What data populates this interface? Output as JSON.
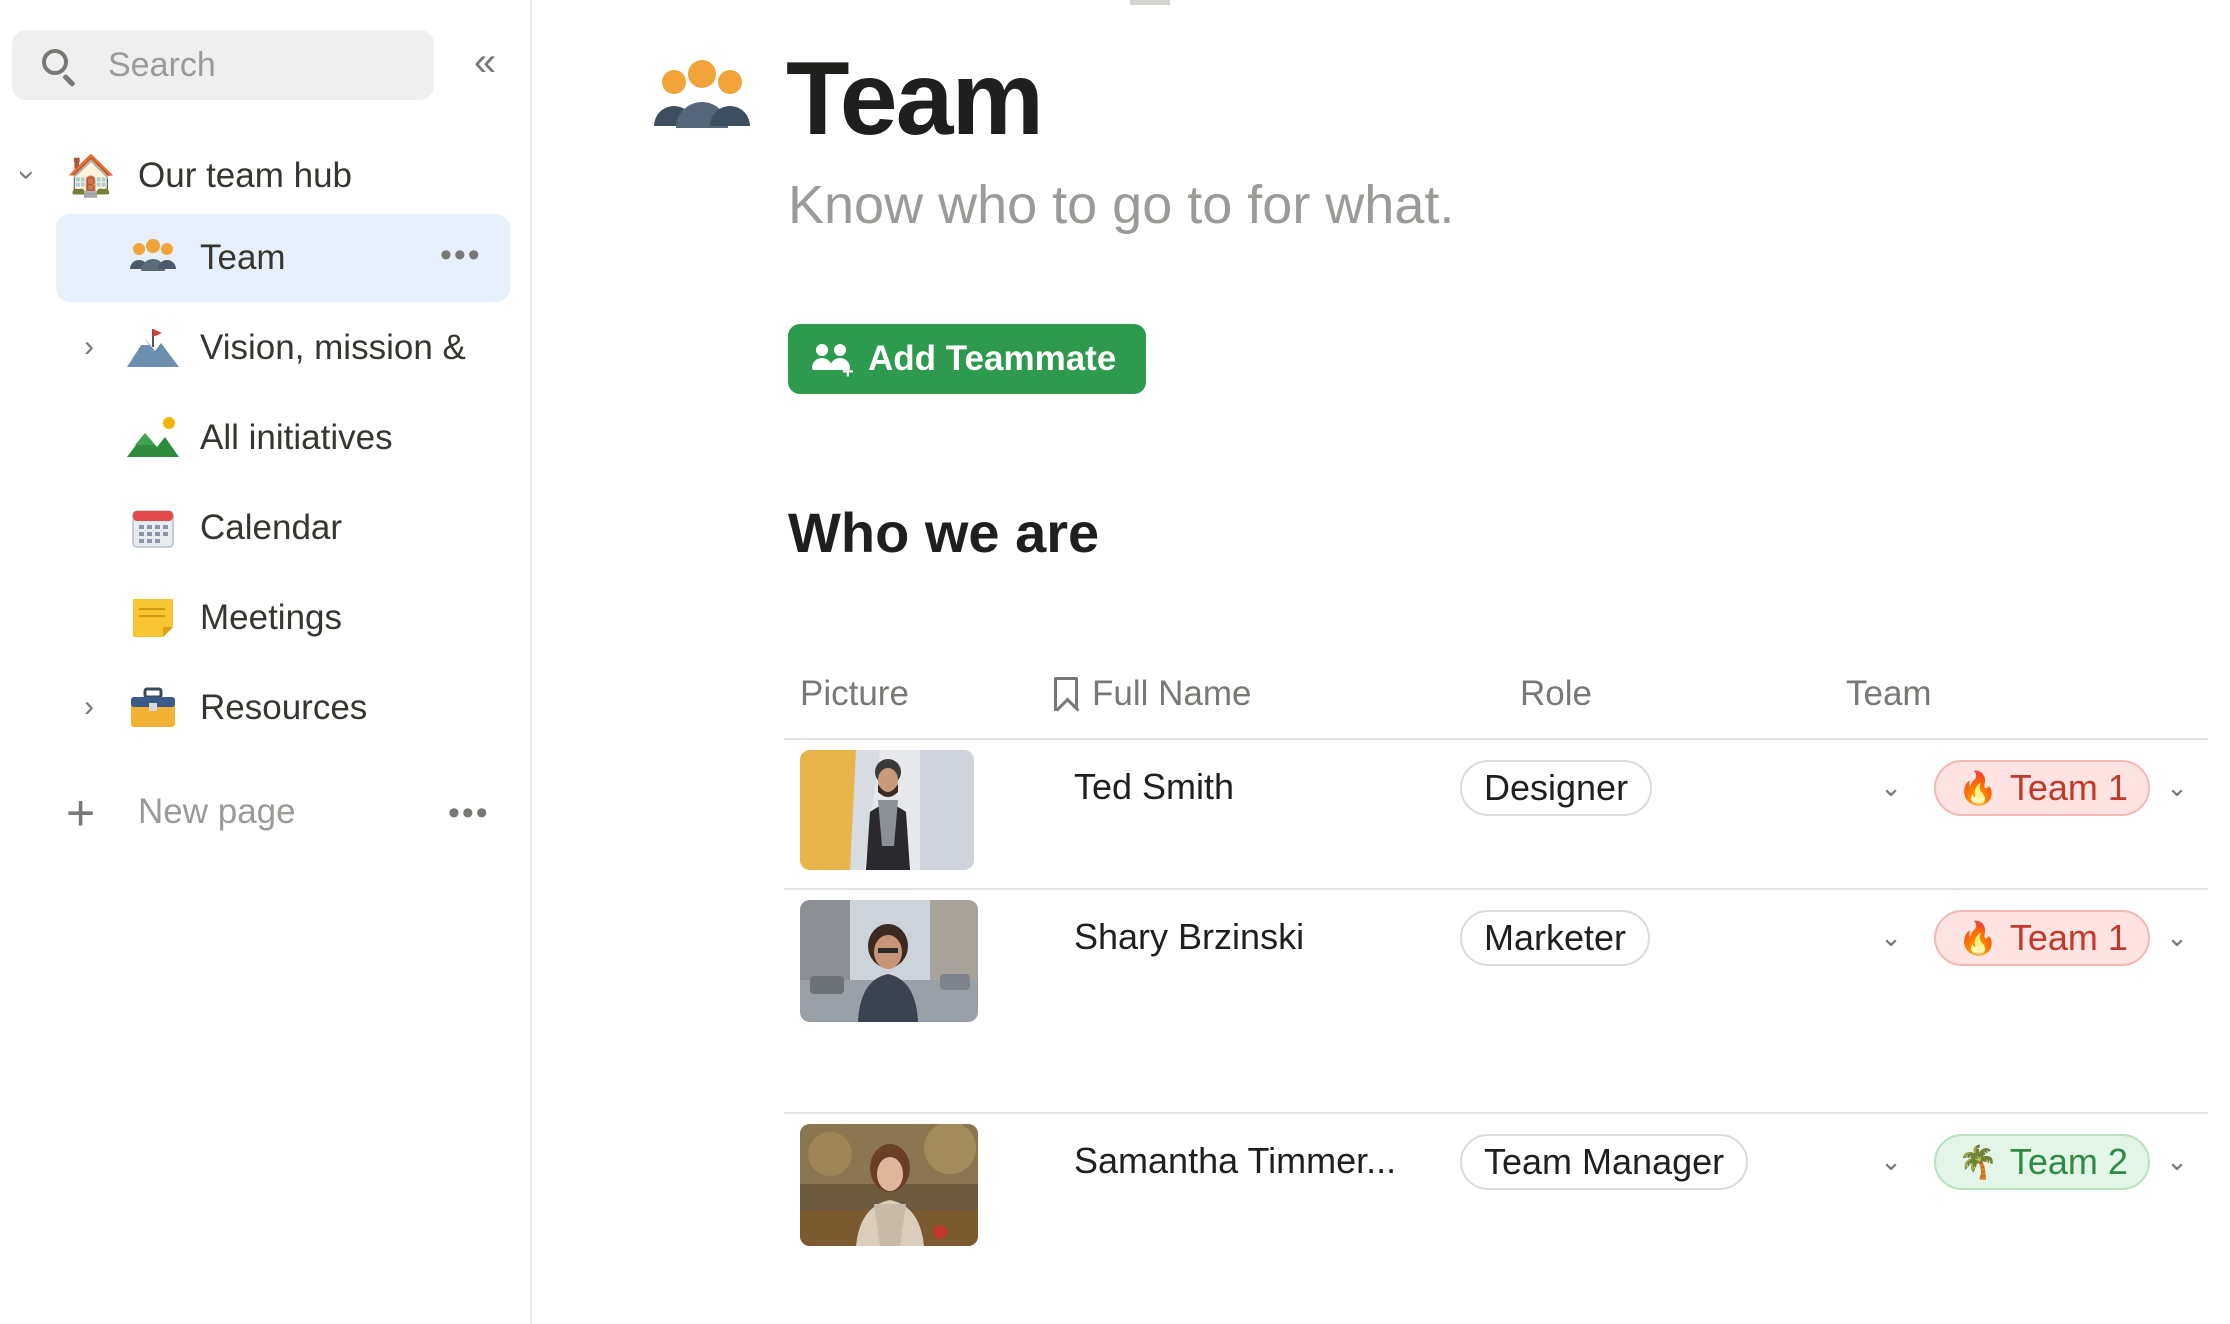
{
  "sidebar": {
    "search_placeholder": "Search",
    "collapse_glyph": "«",
    "items": [
      {
        "label": "Our team hub",
        "icon": "house-icon",
        "glyph": "🏠",
        "expandable": true,
        "expanded": true
      },
      {
        "label": "Team",
        "icon": "team-icon",
        "glyph": "👥",
        "active": true,
        "more": "•••"
      },
      {
        "label": "Vision, mission &",
        "icon": "mountain-flag-icon",
        "glyph": "🏔",
        "expandable": true
      },
      {
        "label": "All initiatives",
        "icon": "landscape-icon",
        "glyph": "⛰"
      },
      {
        "label": "Calendar",
        "icon": "calendar-icon",
        "glyph": "📅"
      },
      {
        "label": "Meetings",
        "icon": "sticky-note-icon",
        "glyph": "📝"
      },
      {
        "label": "Resources",
        "icon": "toolbox-icon",
        "glyph": "🧰",
        "expandable": true
      }
    ],
    "new_page_label": "New page",
    "new_page_more": "•••"
  },
  "page": {
    "icon": "team-icon",
    "title": "Team",
    "subtitle": "Know who to go to for what.",
    "add_button_label": "Add Teammate",
    "section_title": "Who we are"
  },
  "table": {
    "columns": [
      "Picture",
      "Full Name",
      "Role",
      "Team"
    ],
    "rows": [
      {
        "name": "Ted Smith",
        "role": "Designer",
        "team": "Team 1",
        "team_emoji": "🔥",
        "team_color": "red",
        "photo": "man-portrait-photo"
      },
      {
        "name": "Shary Brzinski",
        "role": "Marketer",
        "team": "Team 1",
        "team_emoji": "🔥",
        "team_color": "red",
        "photo": "woman-street-photo"
      },
      {
        "name": "Samantha Timmer...",
        "role": "Team Manager",
        "team": "Team 2",
        "team_emoji": "🌴",
        "team_color": "green",
        "photo": "woman-park-photo"
      }
    ]
  },
  "colors": {
    "accent_green": "#2e9a4e",
    "active_item_bg": "#e8f1fb",
    "team1_bg": "#fde3e1",
    "team2_bg": "#e3f5e6"
  }
}
